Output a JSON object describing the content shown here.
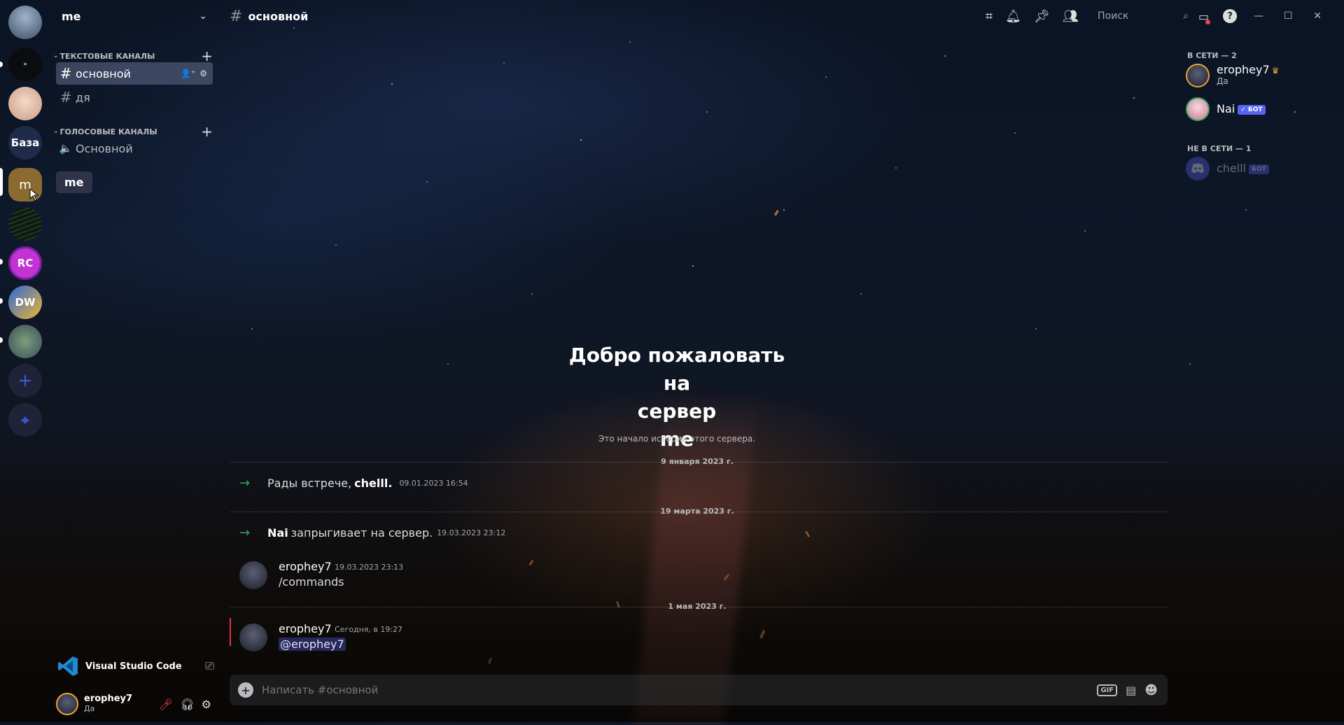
{
  "guild": {
    "name": "me"
  },
  "servers": {
    "items": [
      {
        "label": ""
      },
      {
        "label": "⚬"
      },
      {
        "label": ""
      },
      {
        "label": "База"
      },
      {
        "label": "m"
      },
      {
        "label": ""
      },
      {
        "label": "RC"
      },
      {
        "label": "DW"
      },
      {
        "label": ""
      },
      {
        "label": "+"
      },
      {
        "label": "⌖"
      }
    ],
    "tooltip": "me"
  },
  "channels": {
    "text_category": "Текстовые каналы",
    "voice_category": "Голосовые каналы",
    "text": [
      {
        "label": "основной"
      },
      {
        "label": "дя"
      }
    ],
    "voice": [
      {
        "label": "Основной"
      }
    ]
  },
  "activity": {
    "name": "Visual Studio Code"
  },
  "user": {
    "name": "erophey7",
    "status": "Да"
  },
  "topbar": {
    "channel": "основной",
    "search_placeholder": "Поиск"
  },
  "members": {
    "online_header": "В сети — 2",
    "offline_header": "Не в сети — 1",
    "online": [
      {
        "name": "erophey7",
        "status": "Да",
        "crown": "♛"
      },
      {
        "name": "Nai",
        "badge": "✓ БОТ"
      }
    ],
    "offline": [
      {
        "name": "chelll",
        "badge": "БОТ"
      }
    ]
  },
  "chat": {
    "welcome_line1": "Добро пожаловать на",
    "welcome_line2": "сервер",
    "welcome_line3": "me",
    "welcome_sub": "Это начало истории этого сервера.",
    "dividers": [
      "9 января 2023 г.",
      "19 марта 2023 г.",
      "1 мая 2023 г."
    ],
    "system": [
      {
        "prefix": "Рады встрече,",
        "name": "chelll.",
        "suffix": "",
        "time": "09.01.2023 16:54"
      },
      {
        "prefix": "",
        "name": "Nai",
        "suffix": "запрыгивает на сервер.",
        "time": "19.03.2023 23:12"
      }
    ],
    "messages": [
      {
        "author": "erophey7",
        "time": "19.03.2023 23:13",
        "body": "/commands"
      },
      {
        "author": "erophey7",
        "time": "Сегодня, в 19:27",
        "body": "@erophey7"
      }
    ],
    "composer_placeholder": "Написать #основной",
    "gif_label": "GIF"
  }
}
